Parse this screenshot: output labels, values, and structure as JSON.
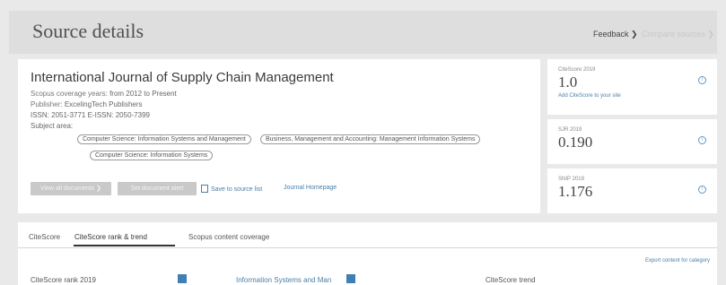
{
  "header": {
    "title": "Source details",
    "feedback_label": "Feedback ❯",
    "compare_label": "Compare sources ❯"
  },
  "source": {
    "title": "International Journal of Supply Chain Management",
    "coverage_label": "Scopus coverage years:",
    "coverage_value": "from 2012 to Present",
    "publisher_label": "Publisher:",
    "publisher_value": "ExcelingTech Publishers",
    "issn_line": "ISSN: 2051-3771  E-ISSN: 2050-7399",
    "subject_label": "Subject area:",
    "subjects": [
      "Computer Science: Information Systems and Management",
      "Business, Management and Accounting: Management Information Systems",
      "Computer Science: Information Systems"
    ]
  },
  "actions": {
    "view_documents": "View all documents ❯",
    "set_alert": "Set document alert",
    "save_to_list": "Save to source list",
    "journal_homepage": "Journal Homepage"
  },
  "metrics": [
    {
      "label": "CiteScore 2019",
      "value": "1.0",
      "link": "Add CiteScore to your site"
    },
    {
      "label": "SJR 2019",
      "value": "0.190"
    },
    {
      "label": "SNIP 2019",
      "value": "1.176"
    }
  ],
  "tabs": [
    {
      "label": "CiteScore"
    },
    {
      "label": "CiteScore rank & trend"
    },
    {
      "label": "Scopus content coverage"
    }
  ],
  "bottom": {
    "export_link": "Export content for category",
    "rank_label": "CiteScore rank 2019",
    "category_label": "Information Systems and Man",
    "trend_label": "CiteScore trend"
  },
  "colors": {
    "accent": "#3f7fb3",
    "link": "#4a7fa8"
  }
}
